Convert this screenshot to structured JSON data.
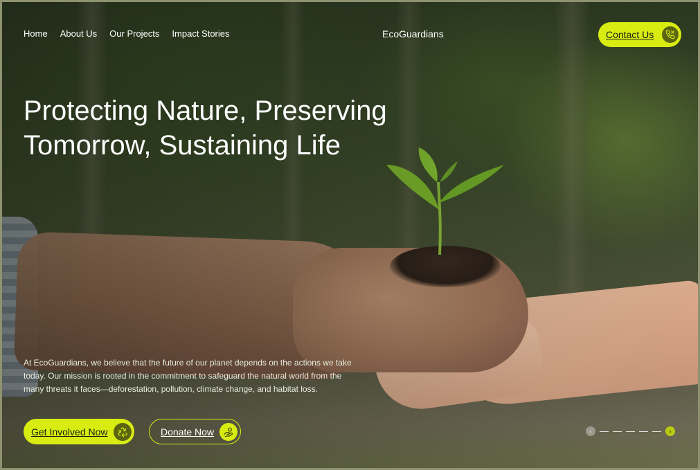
{
  "nav": {
    "items": [
      {
        "label": "Home"
      },
      {
        "label": "About Us"
      },
      {
        "label": "Our Projects"
      },
      {
        "label": "Impact Stories"
      }
    ],
    "brand": "EcoGuardians",
    "contact_label": "Contact Us"
  },
  "hero": {
    "headline_line1": "Protecting Nature, Preserving",
    "headline_line2": "Tomorrow, Sustaining Life",
    "description_line1": "At EcoGuardians, we believe that the future of our planet depends on the actions we take",
    "description_line2": "today. Our mission is rooted in the commitment to safeguard the natural world from the",
    "description_line3": "many threats it faces—deforestation, pollution, climate change, and habitat loss.",
    "primary_cta": "Get Involved Now",
    "secondary_cta": "Donate Now"
  },
  "slider": {
    "prev_icon": "chevron-left-icon",
    "next_icon": "chevron-right-icon",
    "slide_count": 5
  },
  "colors": {
    "accent": "#d8ec12",
    "accent_dark": "#5b6410",
    "text_light": "#ffffff"
  },
  "icons": {
    "contact": "phone-icon",
    "get_involved": "recycle-icon",
    "donate": "hand-coin-icon"
  }
}
